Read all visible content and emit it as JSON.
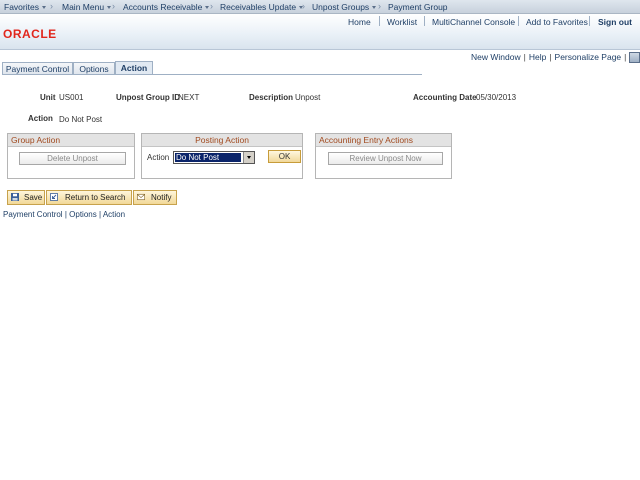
{
  "nav": {
    "breadcrumbs": [
      "Favorites",
      "Main Menu",
      "Accounts Receivable",
      "Receivables Update",
      "Unpost Groups",
      "Payment Group"
    ]
  },
  "header": {
    "logo": "ORACLE",
    "links": [
      "Home",
      "Worklist",
      "MultiChannel Console",
      "Add to Favorites",
      "Sign out"
    ]
  },
  "utility": {
    "new_window": "New Window",
    "help": "Help",
    "personalize": "Personalize Page"
  },
  "tabs": [
    {
      "label": "Payment Control",
      "active": false
    },
    {
      "label": "Options",
      "active": false
    },
    {
      "label": "Action",
      "active": true
    }
  ],
  "fields": {
    "unit_label": "Unit",
    "unit_value": "US001",
    "group_id_label": "Unpost Group ID",
    "group_id_value": "NEXT",
    "description_label": "Description",
    "description_value": "Unpost",
    "acct_date_label": "Accounting Date",
    "acct_date_value": "05/30/2013",
    "action_label": "Action",
    "action_value": "Do Not Post"
  },
  "group_action": {
    "title": "Group Action",
    "button": "Delete Unpost"
  },
  "posting_action": {
    "title": "Posting Action",
    "action_label": "Action",
    "selected": "Do Not Post",
    "ok": "OK"
  },
  "accounting": {
    "title": "Accounting Entry Actions",
    "button": "Review Unpost Now"
  },
  "toolbar": {
    "save": "Save",
    "return": "Return to Search",
    "notify": "Notify"
  },
  "bottom_links": [
    "Payment Control",
    "Options",
    "Action"
  ],
  "colors": {
    "oracle_red": "#e1261c",
    "link_blue": "#1f3f66",
    "group_title": "#a14a1f"
  }
}
